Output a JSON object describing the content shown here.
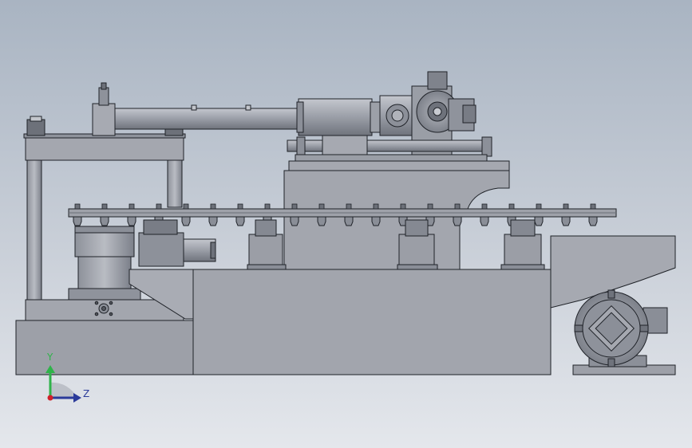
{
  "triad": {
    "y_label": "Y",
    "z_label": "Z"
  },
  "colors": {
    "background_top": "#a9b4c2",
    "background_bottom": "#e4e7ec",
    "steel": "#a0a3ab",
    "steel_dark": "#7e828c",
    "steel_light": "#bdc0c7",
    "edge": "#1f2228",
    "axis_y": "#2fb34a",
    "axis_z": "#2b3b9a",
    "origin": "#d0202a"
  }
}
